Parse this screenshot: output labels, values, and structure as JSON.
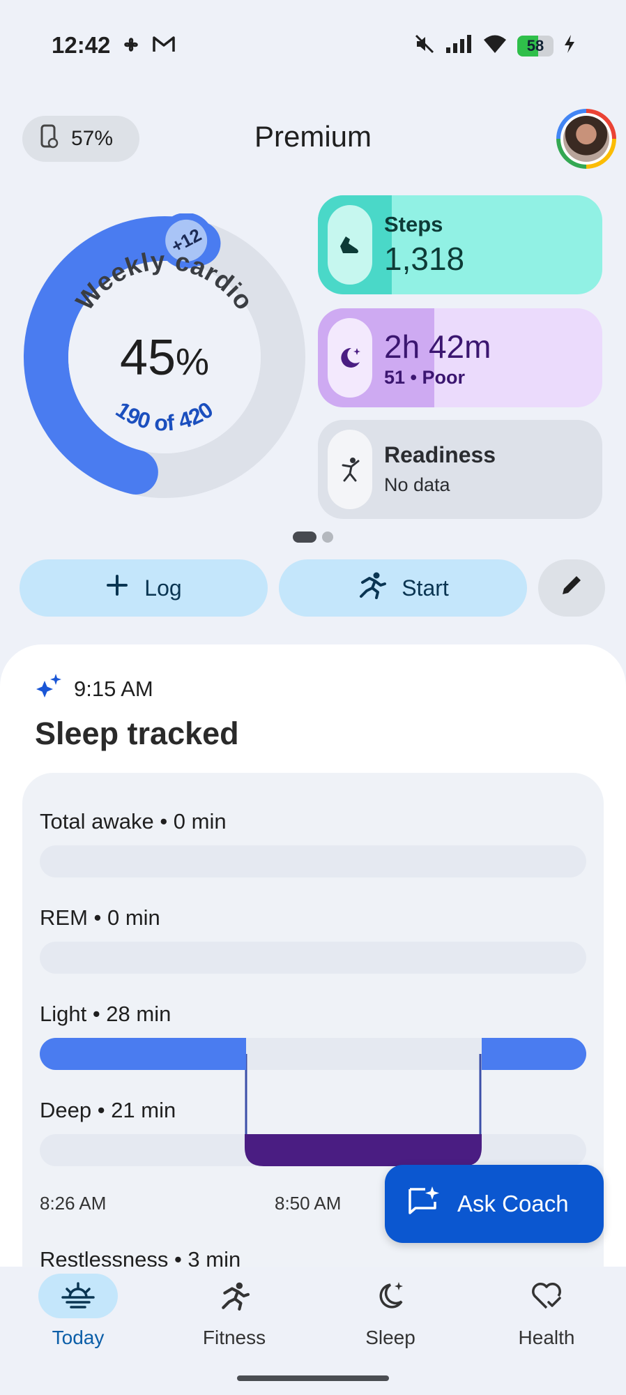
{
  "status_bar": {
    "time": "12:42",
    "battery_percent": 58,
    "battery_label": "58",
    "left_icons": [
      "pinwheel-icon",
      "gmail-icon"
    ],
    "right_icons": [
      "mute-icon",
      "signal-icon",
      "wifi-icon",
      "battery-icon",
      "charging-icon"
    ]
  },
  "header": {
    "device_battery": "57%",
    "title": "Premium"
  },
  "weekly_cardio": {
    "label": "Weekly cardio",
    "badge": "+12",
    "percent_value": "45",
    "percent_symbol": "%",
    "progress_text": "190 of 420",
    "progress_fraction": 0.45
  },
  "metrics": {
    "steps": {
      "title": "Steps",
      "value": "1,318",
      "fill_fraction": 0.26
    },
    "sleep": {
      "value": "2h 42m",
      "detail": "51 • Poor",
      "fill_fraction": 0.41
    },
    "readiness": {
      "title": "Readiness",
      "detail": "No data"
    }
  },
  "actions": {
    "log_label": "Log",
    "start_label": "Start"
  },
  "sleep_section": {
    "time": "9:15 AM",
    "title": "Sleep tracked",
    "stages": [
      {
        "label": "Total awake • 0 min"
      },
      {
        "label": "REM • 0 min"
      },
      {
        "label": "Light • 28 min"
      },
      {
        "label": "Deep • 21 min"
      }
    ],
    "axis_ticks": [
      "8:26 AM",
      "8:50 AM"
    ],
    "restlessness": "Restlessness • 3 min"
  },
  "ask_coach": {
    "label": "Ask Coach"
  },
  "colors": {
    "accent_blue": "#4a7cf0",
    "deep_purple": "#4a1d82",
    "coach_blue": "#0b57d0",
    "steps_teal": "#91f1e4",
    "sleep_lilac": "#ebdbfc"
  },
  "nav": {
    "items": [
      {
        "label": "Today",
        "icon": "sunrise-icon",
        "active": true
      },
      {
        "label": "Fitness",
        "icon": "running-icon",
        "active": false
      },
      {
        "label": "Sleep",
        "icon": "moon-sparkle-icon",
        "active": false
      },
      {
        "label": "Health",
        "icon": "heart-check-icon",
        "active": false
      }
    ]
  }
}
